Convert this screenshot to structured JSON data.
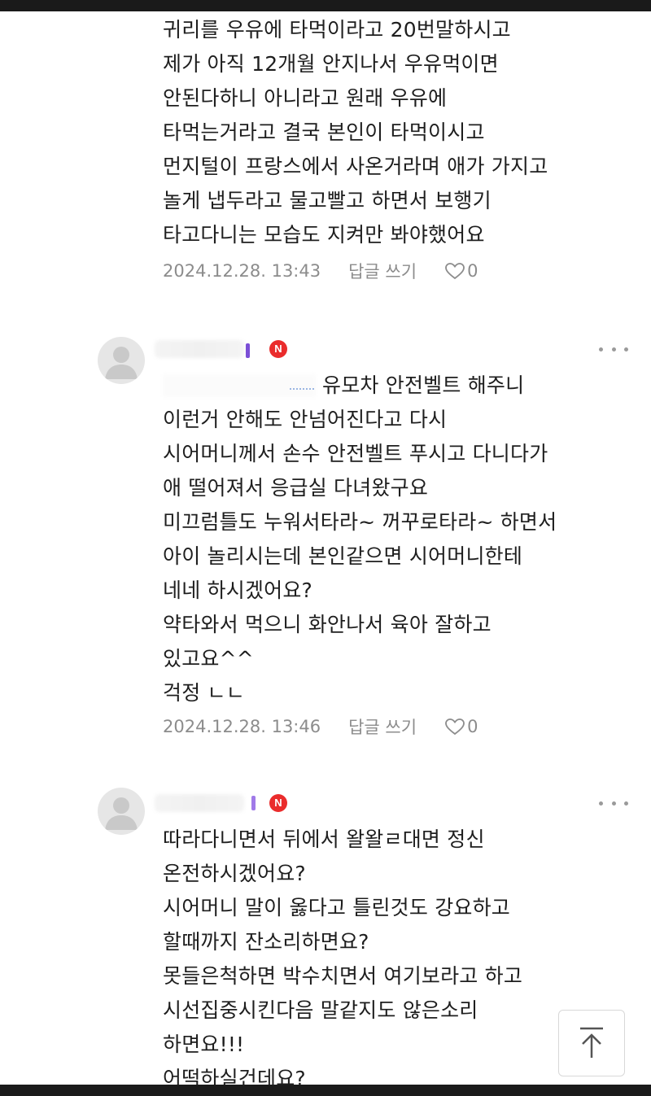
{
  "comments": [
    {
      "lines": [
        "귀리를 우유에 타먹이라고 20번말하시고",
        "제가 아직 12개월 안지나서 우유먹이면",
        "안된다하니 아니라고 원래 우유에",
        "타먹는거라고 결국 본인이 타먹이시고",
        "먼지털이 프랑스에서 사온거라며 애가 가지고",
        "놀게 냅두라고 물고빨고 하면서 보행기",
        "타고다니는 모습도 지켜만 봐야했어요"
      ],
      "date": "2024.12.28. 13:43",
      "reply_label": "답글 쓰기",
      "like_count": "0"
    },
    {
      "badge": "N",
      "first_line": "유모차 안전벨트 해주니",
      "lines": [
        "이런거 안해도 안넘어진다고 다시",
        "시어머니께서 손수 안전벨트 푸시고 다니다가",
        "애 떨어져서 응급실 다녀왔구요",
        "미끄럼틀도 누워서타라~ 꺼꾸로타라~ 하면서",
        "아이 놀리시는데 본인같으면 시어머니한테",
        "네네 하시겠어요?",
        "약타와서 먹으니 화안나서 육아 잘하고",
        "있고요^^",
        "걱정 ㄴㄴ"
      ],
      "date": "2024.12.28. 13:46",
      "reply_label": "답글 쓰기",
      "like_count": "0"
    },
    {
      "badge": "N",
      "lines": [
        "따라다니면서 뒤에서 왈왈ㄹ대면 정신",
        "온전하시겠어요?",
        "시어머니 말이 옳다고 틀린것도 강요하고",
        "할때까지 잔소리하면요?",
        "못들은척하면 박수치면서 여기보라고 하고",
        "시선집중시킨다음 말같지도 않은소리",
        "하면요!!!",
        "어떡하실건데요?"
      ]
    }
  ],
  "colors": {
    "text": "#1e1e1e",
    "meta": "#8c8c8c",
    "badge": "#ea2c2c",
    "nick_tail_2": "#7b4fd6",
    "nick_tail_3": "#a07ae8"
  },
  "icons": {
    "like": "heart-outline-icon",
    "more": "more-dots-icon",
    "scroll_top": "arrow-up-icon",
    "avatar": "default-profile-icon"
  }
}
